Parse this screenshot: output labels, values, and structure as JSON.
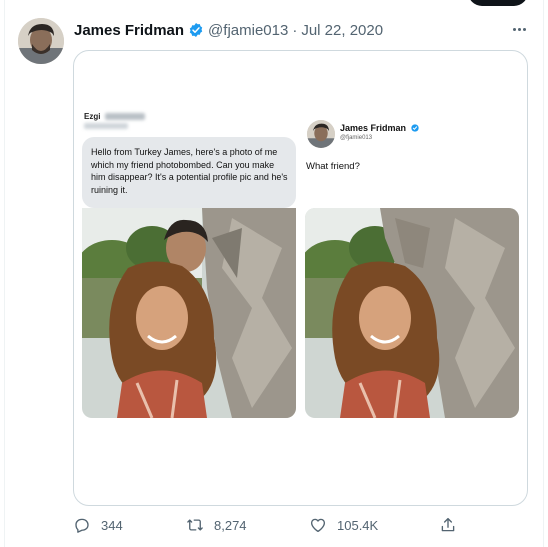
{
  "top_strip": {
    "count_text": ""
  },
  "tweet": {
    "display_name": "James Fridman",
    "handle": "@fjamie013",
    "separator": "·",
    "date": "Jul 22, 2020"
  },
  "media": {
    "left_panel": {
      "sender_name": "Ezgi",
      "message": "Hello from Turkey James, here's a photo of me which my friend photobombed. Can you make him disappear? It's a potential profile pic and he's ruining it."
    },
    "right_panel": {
      "name": "James Fridman",
      "handle": "@fjamie013",
      "reply": "What friend?"
    }
  },
  "actions": {
    "replies": "344",
    "retweets": "8,274",
    "likes": "105.4K"
  },
  "colors": {
    "verified": "#1d9bf0",
    "muted_text": "#536471",
    "border": "#cfd9de",
    "dm_bubble": "#e5e8eb"
  },
  "icons": [
    "verified-badge-icon",
    "more-icon",
    "reply-icon",
    "retweet-icon",
    "like-icon",
    "share-icon"
  ]
}
